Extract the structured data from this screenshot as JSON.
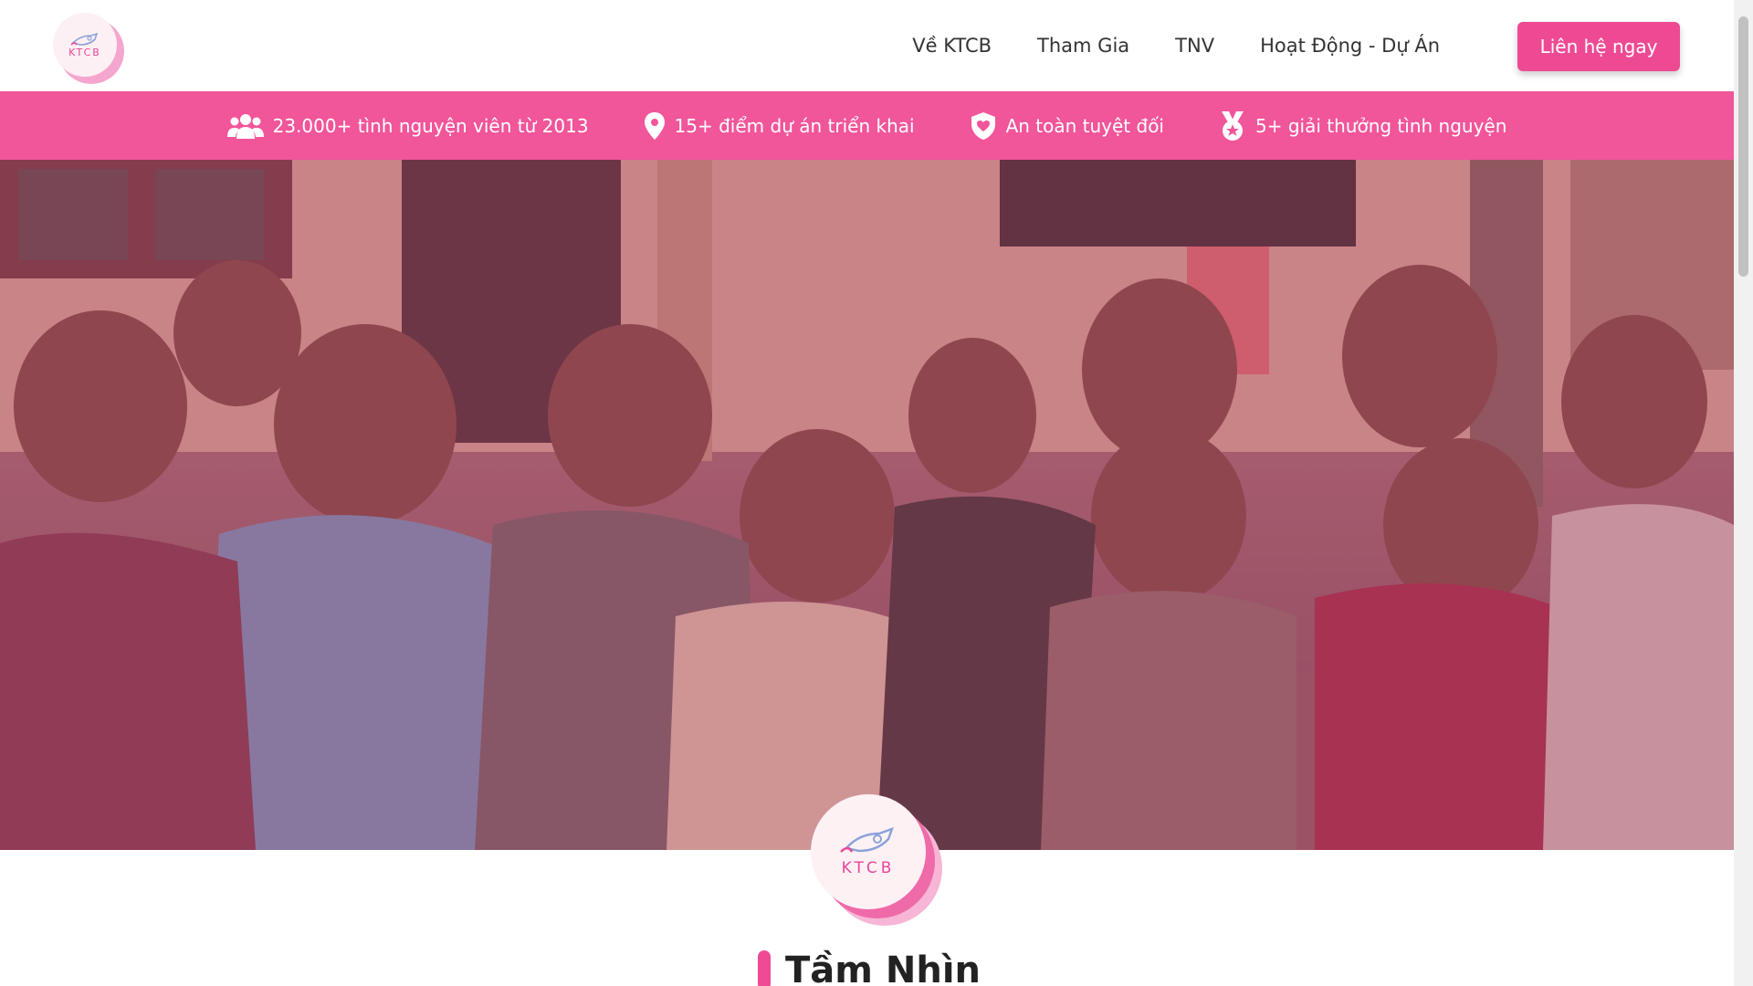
{
  "header": {
    "logo_text": "KTCB",
    "nav": [
      "Về KTCB",
      "Tham Gia",
      "TNV",
      "Hoạt Động - Dự Án"
    ],
    "cta_label": "Liên hệ ngay"
  },
  "stats": [
    {
      "icon": "users-icon",
      "text": "23.000+ tình nguyện viên từ 2013"
    },
    {
      "icon": "map-pin-icon",
      "text": "15+ điểm dự án triển khai"
    },
    {
      "icon": "shield-heart-icon",
      "text": "An toàn tuyệt đối"
    },
    {
      "icon": "medal-icon",
      "text": "5+ giải thưởng tình nguyện"
    }
  ],
  "center_logo_text": "KTCB",
  "section": {
    "title": "Tầm Nhìn"
  },
  "colors": {
    "brand_pink": "#f1559a",
    "cta": "#ee4a94",
    "logo_pink": "#e8479a"
  }
}
